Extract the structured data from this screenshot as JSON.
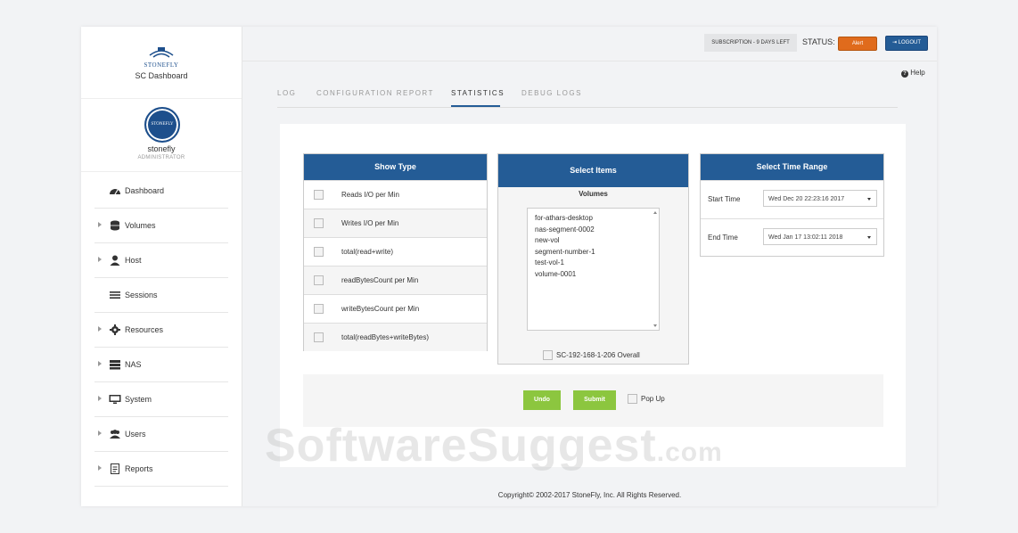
{
  "brand": {
    "logo_text": "STONEFLY",
    "title": "SC Dashboard"
  },
  "user": {
    "avatar_text": "STONEFLY",
    "name": "stonefly",
    "role": "ADMINISTRATOR"
  },
  "nav": [
    {
      "label": "Dashboard",
      "icon": "dashboard-icon",
      "expandable": false
    },
    {
      "label": "Volumes",
      "icon": "database-icon",
      "expandable": true
    },
    {
      "label": "Host",
      "icon": "user-icon",
      "expandable": true
    },
    {
      "label": "Sessions",
      "icon": "list-icon",
      "expandable": false
    },
    {
      "label": "Resources",
      "icon": "gear-icon",
      "expandable": true
    },
    {
      "label": "NAS",
      "icon": "server-icon",
      "expandable": true
    },
    {
      "label": "System",
      "icon": "monitor-icon",
      "expandable": true
    },
    {
      "label": "Users",
      "icon": "users-icon",
      "expandable": true
    },
    {
      "label": "Reports",
      "icon": "report-icon",
      "expandable": true
    }
  ],
  "topbar": {
    "subscription": "SUBSCRIPTION - 9 DAYS LEFT",
    "status_label": "STATUS:",
    "alert_label": "Alert",
    "logout_label": "LOGOUT"
  },
  "help": "Help",
  "tabs": [
    {
      "label": "LOG",
      "active": false
    },
    {
      "label": "CONFIGURATION REPORT",
      "active": false
    },
    {
      "label": "STATISTICS",
      "active": true
    },
    {
      "label": "DEBUG LOGS",
      "active": false
    }
  ],
  "show_type": {
    "header": "Show Type",
    "items": [
      "Reads I/O per Min",
      "Writes I/O per Min",
      "total(read+write)",
      "readBytesCount per Min",
      "writeBytesCount per Min",
      "total(readBytes+writeBytes)"
    ]
  },
  "select_items": {
    "header": "Select Items",
    "subheader": "Volumes",
    "volumes": [
      "for-athars-desktop",
      "nas-segment-0002",
      "new-vol",
      "segment-number-1",
      "test-vol-1",
      "volume-0001"
    ],
    "overall_label": "SC-192-168-1-206 Overall"
  },
  "time_range": {
    "header": "Select Time Range",
    "start_label": "Start Time",
    "start_value": "Wed Dec 20 22:23:16 2017",
    "end_label": "End Time",
    "end_value": "Wed Jan 17 13:02:11 2018"
  },
  "actions": {
    "undo": "Undo",
    "submit": "Submit",
    "popup": "Pop Up"
  },
  "footer": "Copyright© 2002-2017 StoneFly, Inc. All Rights Reserved.",
  "watermark": {
    "main": "SoftwareSuggest",
    "suffix": ".com"
  }
}
